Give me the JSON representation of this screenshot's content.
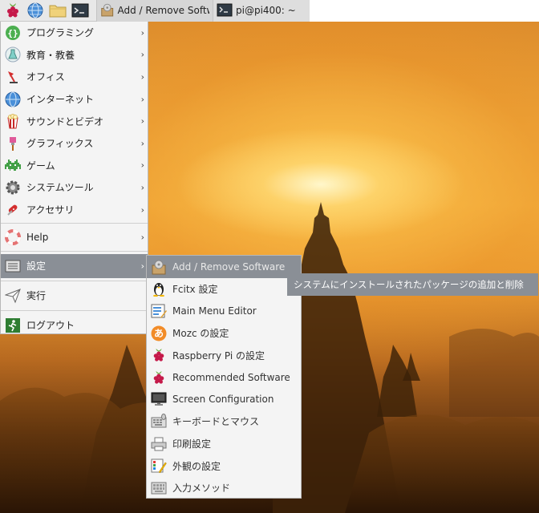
{
  "taskbar": {
    "tasks": [
      {
        "label": "Add / Remove Softw..."
      },
      {
        "label": "pi@pi400: ~"
      }
    ]
  },
  "menu": {
    "items": [
      {
        "label": "プログラミング"
      },
      {
        "label": "教育・教養"
      },
      {
        "label": "オフィス"
      },
      {
        "label": "インターネット"
      },
      {
        "label": "サウンドとビデオ"
      },
      {
        "label": "グラフィックス"
      },
      {
        "label": "ゲーム"
      },
      {
        "label": "システムツール"
      },
      {
        "label": "アクセサリ"
      },
      {
        "label": "Help"
      },
      {
        "label": "設定"
      },
      {
        "label": "実行"
      },
      {
        "label": "ログアウト"
      }
    ],
    "arrow_glyph": "›"
  },
  "submenu": {
    "items": [
      {
        "label": "Add / Remove Software"
      },
      {
        "label": "Fcitx 設定"
      },
      {
        "label": "Main Menu Editor"
      },
      {
        "label": "Mozc の設定"
      },
      {
        "label": "Raspberry Pi の設定"
      },
      {
        "label": "Recommended Software"
      },
      {
        "label": "Screen Configuration"
      },
      {
        "label": "キーボードとマウス"
      },
      {
        "label": "印刷設定"
      },
      {
        "label": "外観の設定"
      },
      {
        "label": "入力メソッド"
      }
    ]
  },
  "tooltip": {
    "text": "システムにインストールされたパッケージの追加と削除"
  },
  "icons": {
    "mozc_glyph": "あ"
  },
  "colors": {
    "highlight": "#8a8f96",
    "menu_bg": "#f4f4f4",
    "taskbar_bg": "#e8e8e8",
    "raspberry": "#c51a4a"
  }
}
